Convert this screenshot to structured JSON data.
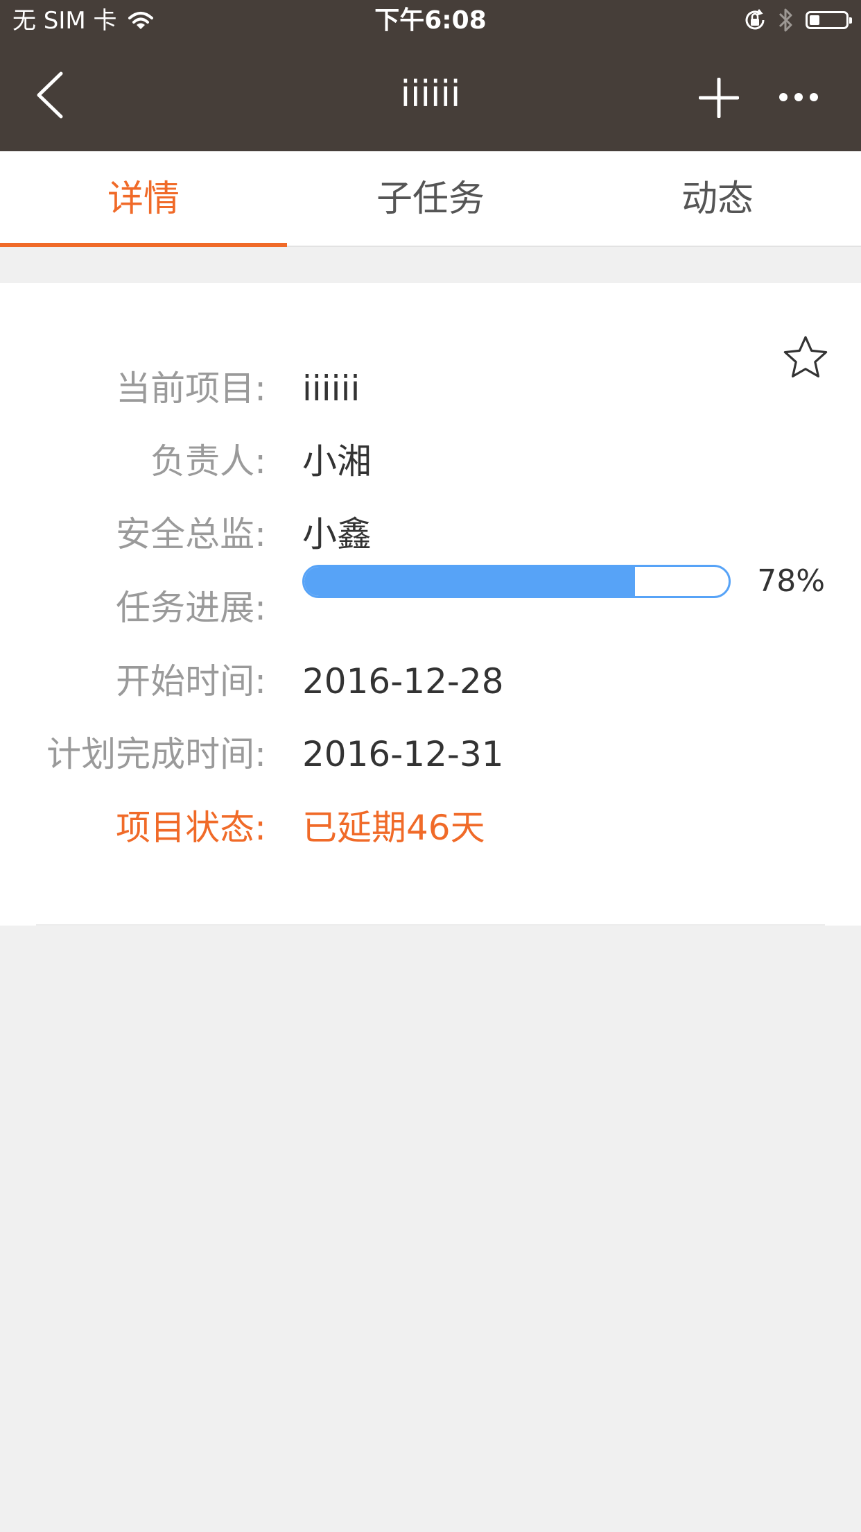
{
  "status_bar": {
    "carrier": "无 SIM 卡",
    "time": "下午6:08"
  },
  "navbar": {
    "title": "iiiiii"
  },
  "tabs": [
    {
      "label": "详情",
      "active": true
    },
    {
      "label": "子任务",
      "active": false
    },
    {
      "label": "动态",
      "active": false
    }
  ],
  "details": {
    "project_label": "当前项目:",
    "project_value": "iiiiii",
    "owner_label": "负责人:",
    "owner_value": "小湘",
    "safety_label": "安全总监:",
    "safety_value": "小鑫",
    "progress_label": "任务进展:",
    "progress_value": 0.78,
    "progress_text": "78%",
    "start_label": "开始时间:",
    "start_value": "2016-12-28",
    "plan_label": "计划完成时间:",
    "plan_value": "2016-12-31",
    "status_label": "项目状态:",
    "status_value": "已延期46天"
  },
  "icons": {
    "wifi": "wifi-icon",
    "lock_rotation": "orientation-lock-icon",
    "bluetooth": "bluetooth-icon",
    "battery": "battery-icon",
    "back": "chevron-left-icon",
    "add": "plus-icon",
    "more": "more-icon",
    "star": "star-icon"
  },
  "colors": {
    "header_bg": "#463e39",
    "accent": "#f06a28",
    "progress": "#57a3f7",
    "page_bg": "#f0f0f0"
  },
  "battery_level": 0.25
}
